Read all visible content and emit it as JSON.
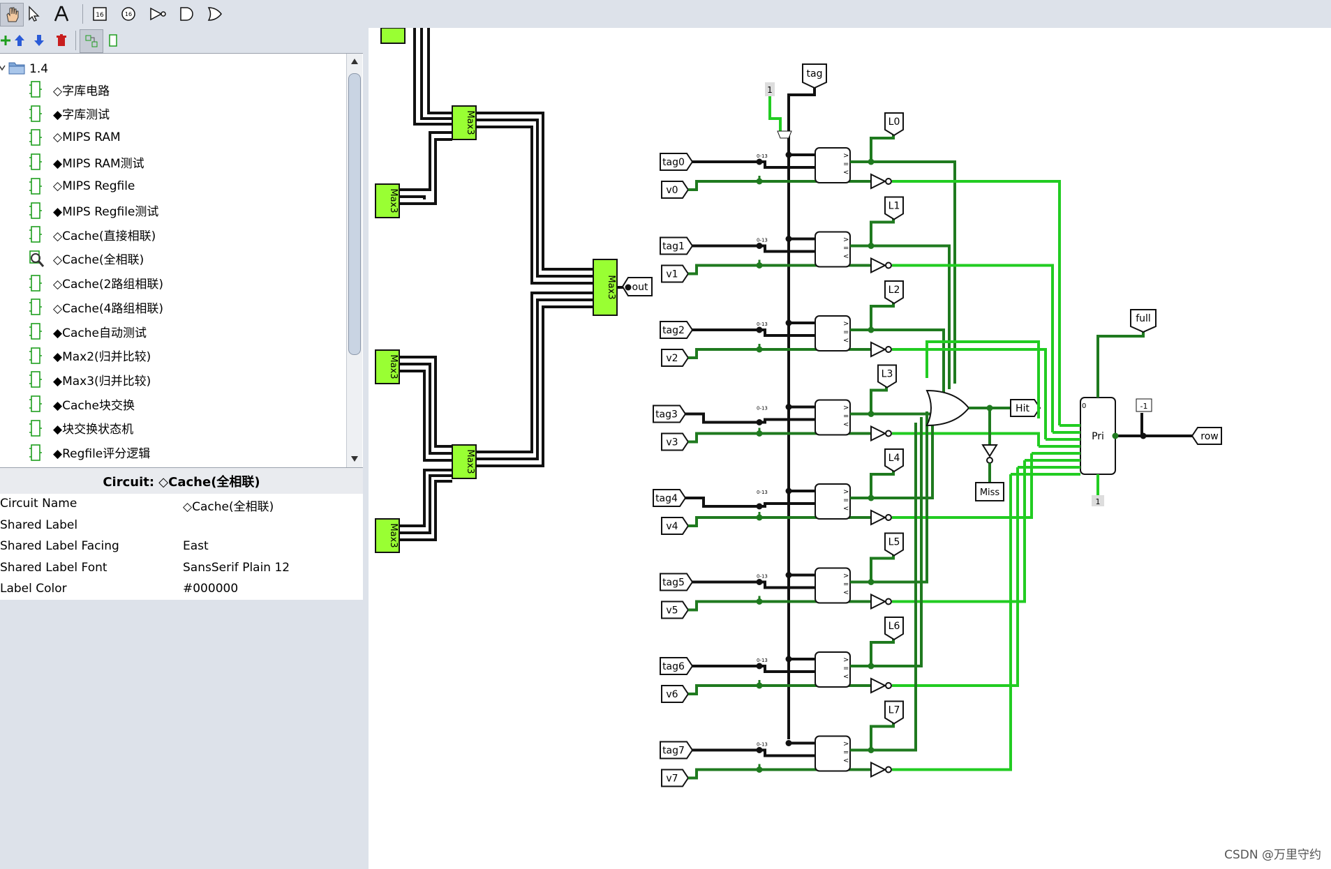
{
  "tree": {
    "root_label": "1.4",
    "items": [
      {
        "label": "◇字库电路"
      },
      {
        "label": "◆字库测试"
      },
      {
        "label": "◇MIPS RAM"
      },
      {
        "label": "◆MIPS RAM测试"
      },
      {
        "label": "◇MIPS Regfile"
      },
      {
        "label": "◆MIPS Regfile测试"
      },
      {
        "label": "◇Cache(直接相联)"
      },
      {
        "label": "◇Cache(全相联)",
        "selected": true
      },
      {
        "label": "◇Cache(2路组相联)"
      },
      {
        "label": "◇Cache(4路组相联)"
      },
      {
        "label": "◆Cache自动测试"
      },
      {
        "label": "◆Max2(归并比较)"
      },
      {
        "label": "◆Max3(归并比较)"
      },
      {
        "label": "◆Cache块交换"
      },
      {
        "label": "◆块交换状态机"
      },
      {
        "label": "◆Regfile评分逻辑"
      }
    ]
  },
  "attributes": {
    "title": "Circuit: ◇Cache(全相联)",
    "rows": [
      {
        "key": "Circuit Name",
        "value": "◇Cache(全相联)"
      },
      {
        "key": "Shared Label",
        "value": ""
      },
      {
        "key": "Shared Label Facing",
        "value": "East"
      },
      {
        "key": "Shared Label Font",
        "value": "SansSerif Plain 12"
      },
      {
        "key": "Label Color",
        "value": "#000000"
      }
    ]
  },
  "circuit": {
    "max_label": "Max3",
    "out_label": "out",
    "tag_label": "tag",
    "one_label": "1",
    "minus_one_label": "-1",
    "zero_label": "0",
    "pri_label": "Pri",
    "hit_label": "Hit",
    "miss_label": "Miss",
    "full_label": "full",
    "row_label": "row",
    "lines": [
      {
        "tag": "tag0",
        "v": "v0",
        "l": "L0"
      },
      {
        "tag": "tag1",
        "v": "v1",
        "l": "L1"
      },
      {
        "tag": "tag2",
        "v": "v2",
        "l": "L2"
      },
      {
        "tag": "tag3",
        "v": "v3",
        "l": "L3"
      },
      {
        "tag": "tag4",
        "v": "v4",
        "l": "L4"
      },
      {
        "tag": "tag5",
        "v": "v5",
        "l": "L5"
      },
      {
        "tag": "tag6",
        "v": "v6",
        "l": "L6"
      },
      {
        "tag": "tag7",
        "v": "v7",
        "l": "L7"
      }
    ]
  },
  "watermark": "CSDN @万里守约",
  "colors": {
    "wire_dark": "#1f7a1f",
    "wire_light": "#22cc22",
    "component": "#99ff33"
  }
}
